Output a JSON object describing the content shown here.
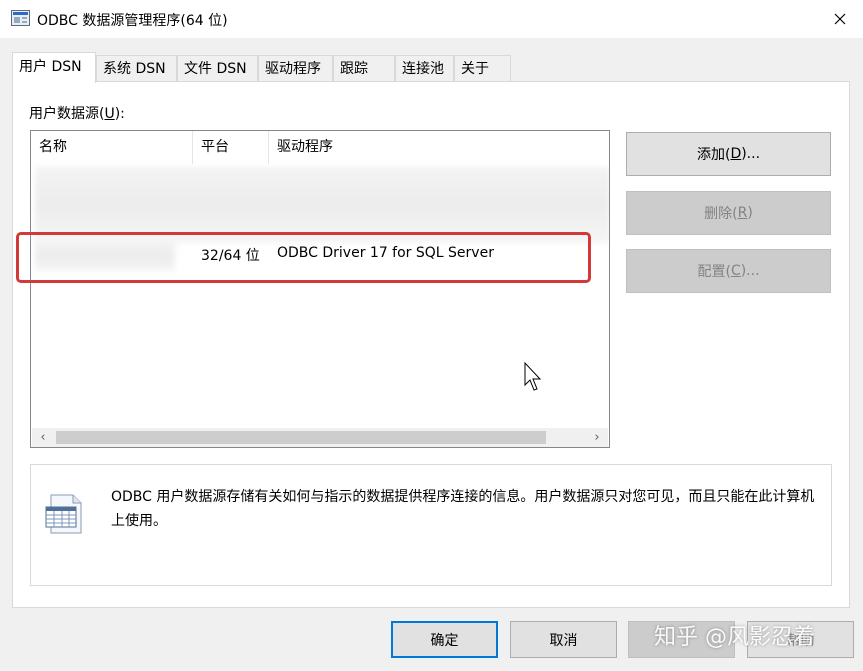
{
  "window": {
    "title": "ODBC 数据源管理程序(64 位)"
  },
  "tabs": [
    {
      "label": "用户 DSN",
      "active": true
    },
    {
      "label": "系统 DSN",
      "active": false
    },
    {
      "label": "文件 DSN",
      "active": false
    },
    {
      "label": "驱动程序",
      "active": false
    },
    {
      "label": "跟踪",
      "active": false
    },
    {
      "label": "连接池",
      "active": false
    },
    {
      "label": "关于",
      "active": false
    }
  ],
  "list": {
    "label_prefix": "用户数据源(",
    "label_key": "U",
    "label_suffix": "):",
    "columns": [
      "名称",
      "平台",
      "驱动程序"
    ],
    "rows": [
      {
        "name": "",
        "platform": "32/64 位",
        "driver": "ODBC Driver 17 for SQL Server"
      }
    ]
  },
  "buttons": {
    "add": {
      "label": "添加(",
      "key": "D",
      "suffix": ")..."
    },
    "remove": {
      "label": "删除(",
      "key": "R",
      "suffix": ")"
    },
    "configure": {
      "label": "配置(",
      "key": "C",
      "suffix": ")..."
    },
    "ok": "确定",
    "cancel": "取消",
    "apply": "",
    "help": "帮助"
  },
  "info": {
    "text": "ODBC 用户数据源存储有关如何与指示的数据提供程序连接的信息。用户数据源只对您可见，而且只能在此计算机上使用。"
  },
  "watermark": "知乎 @风影忍着",
  "colors": {
    "highlight": "#d23a3a",
    "default_button_border": "#0078d7",
    "dialog_bg": "#f0f0f0"
  }
}
